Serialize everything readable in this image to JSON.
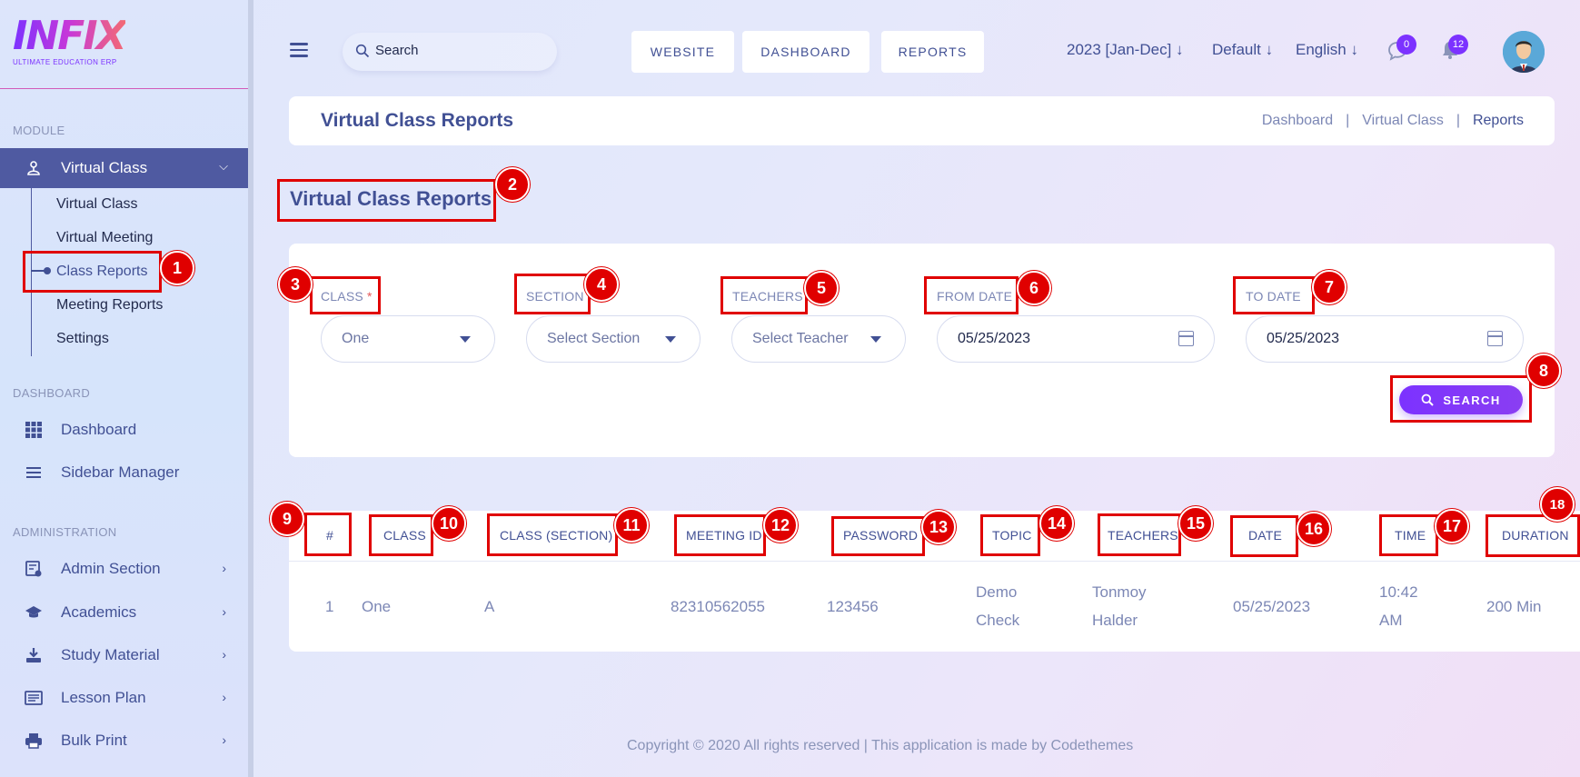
{
  "app": {
    "logo_text": "INFIX",
    "logo_subtitle": "ULTIMATE EDUCATION ERP"
  },
  "sidebar": {
    "module_title": "MODULE",
    "active_menu": {
      "label": "Virtual Class",
      "icon": "virtual-class-icon"
    },
    "sub_items": [
      {
        "label": "Virtual Class"
      },
      {
        "label": "Virtual Meeting"
      },
      {
        "label": "Class Reports"
      },
      {
        "label": "Meeting Reports"
      },
      {
        "label": "Settings"
      }
    ],
    "dashboard_title": "DASHBOARD",
    "dashboard_items": [
      {
        "label": "Dashboard",
        "icon": "grid-icon"
      },
      {
        "label": "Sidebar Manager",
        "icon": "menu-icon"
      }
    ],
    "admin_title": "ADMINISTRATION",
    "admin_items": [
      {
        "label": "Admin Section",
        "icon": "admin-icon"
      },
      {
        "label": "Academics",
        "icon": "graduation-cap-icon"
      },
      {
        "label": "Study Material",
        "icon": "download-icon"
      },
      {
        "label": "Lesson Plan",
        "icon": "list-icon"
      },
      {
        "label": "Bulk Print",
        "icon": "printer-icon"
      }
    ]
  },
  "topbar": {
    "search_placeholder": "Search",
    "buttons": [
      "WEBSITE",
      "DASHBOARD",
      "REPORTS"
    ],
    "session": "2023 [Jan-Dec]",
    "style": "Default",
    "language": "English",
    "message_count": "0",
    "notification_count": "12"
  },
  "header": {
    "title": "Virtual Class Reports",
    "breadcrumb": [
      "Dashboard",
      "|",
      "Virtual Class",
      "|",
      "Reports"
    ]
  },
  "filters": {
    "section_title": "Virtual Class Reports",
    "class_label": "CLASS",
    "class_required": "*",
    "class_value": "One",
    "section_label": "SECTION",
    "section_value": "Select Section",
    "teachers_label": "TEACHERS",
    "teachers_value": "Select Teacher",
    "from_date_label": "FROM DATE",
    "from_date_value": "05/25/2023",
    "to_date_label": "TO DATE",
    "to_date_value": "05/25/2023",
    "search_button": "SEARCH"
  },
  "table": {
    "headers": [
      "#",
      "CLASS",
      "CLASS (SECTION)",
      "MEETING ID",
      "PASSWORD",
      "TOPIC",
      "TEACHERS",
      "DATE",
      "TIME",
      "DURATION"
    ],
    "rows": [
      {
        "num": "1",
        "class": "One",
        "section": "A",
        "meeting_id": "82310562055",
        "password": "123456",
        "topic_1": "Demo",
        "topic_2": "Check",
        "teacher_1": "Tonmoy",
        "teacher_2": "Halder",
        "date": "05/25/2023",
        "time_1": "10:42",
        "time_2": "AM",
        "duration": "200 Min"
      }
    ]
  },
  "footer": {
    "text": "Copyright © 2020 All rights reserved | This application is made by Codethemes"
  },
  "annotations": [
    "1",
    "2",
    "3",
    "4",
    "5",
    "6",
    "7",
    "8",
    "9",
    "10",
    "11",
    "12",
    "13",
    "14",
    "15",
    "16",
    "17",
    "18"
  ],
  "colors": {
    "primary": "#415094",
    "accent": "#7c32ff",
    "annotation": "#e00000"
  }
}
